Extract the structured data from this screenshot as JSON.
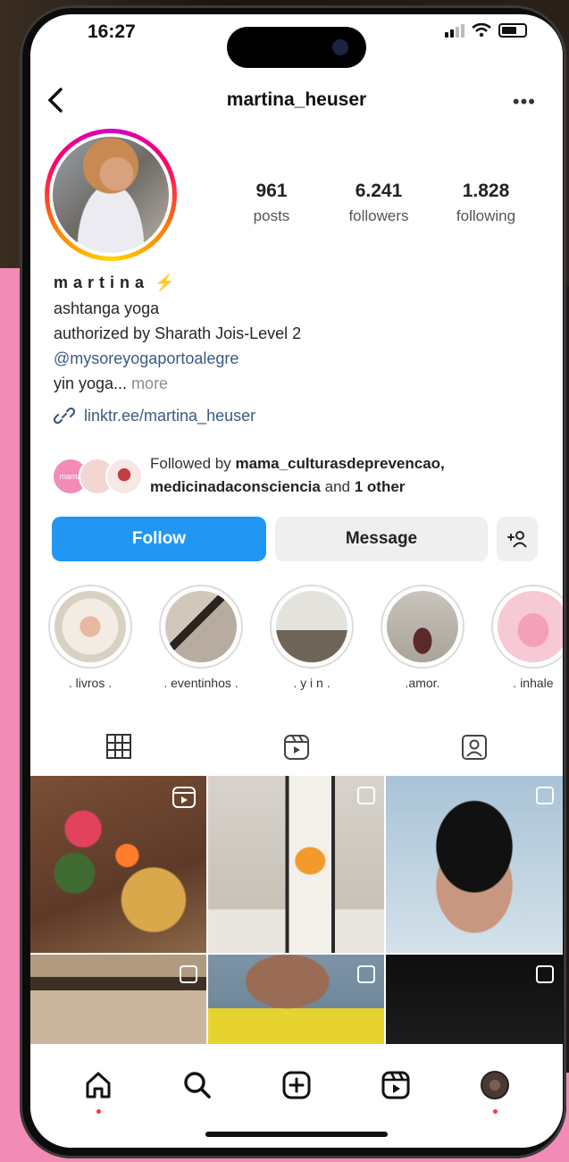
{
  "status": {
    "time": "16:27"
  },
  "profile": {
    "username": "martina_heuser",
    "display_name": "martina",
    "stats": [
      {
        "value": "961",
        "label": "posts"
      },
      {
        "value": "6.241",
        "label": "followers"
      },
      {
        "value": "1.828",
        "label": "following"
      }
    ],
    "bio_lines": [
      "ashtanga yoga",
      "authorized by Sharath Jois-Level 2"
    ],
    "mention": "@mysoreyogaportoalegre",
    "bio_last": "yin yoga...",
    "more_label": "more",
    "link": "linktr.ee/martina_heuser",
    "followed_by_prefix": "Followed by",
    "followed_user_1": "mama_culturasdeprevencao,",
    "followed_user_2": "medicinadaconsciencia",
    "followed_and": "and",
    "followed_other": "1 other",
    "fav1_text": "mama"
  },
  "buttons": {
    "follow": "Follow",
    "message": "Message",
    "add_person": "+⁠ 8"
  },
  "highlights": [
    {
      "label": ". livros ."
    },
    {
      "label": ". eventinhos ."
    },
    {
      "label": ". y i n ."
    },
    {
      "label": ".amor."
    },
    {
      "label": ". inhale"
    }
  ],
  "colors": {
    "follow_button": "#2196f3",
    "link": "#3b5a84",
    "notification_dot": "#ff3040"
  },
  "tab_icons": [
    "grid-icon",
    "reels-icon",
    "tagged-icon"
  ],
  "nav_icons": [
    "home-icon",
    "search-icon",
    "create-icon",
    "reels-icon",
    "profile-icon"
  ]
}
